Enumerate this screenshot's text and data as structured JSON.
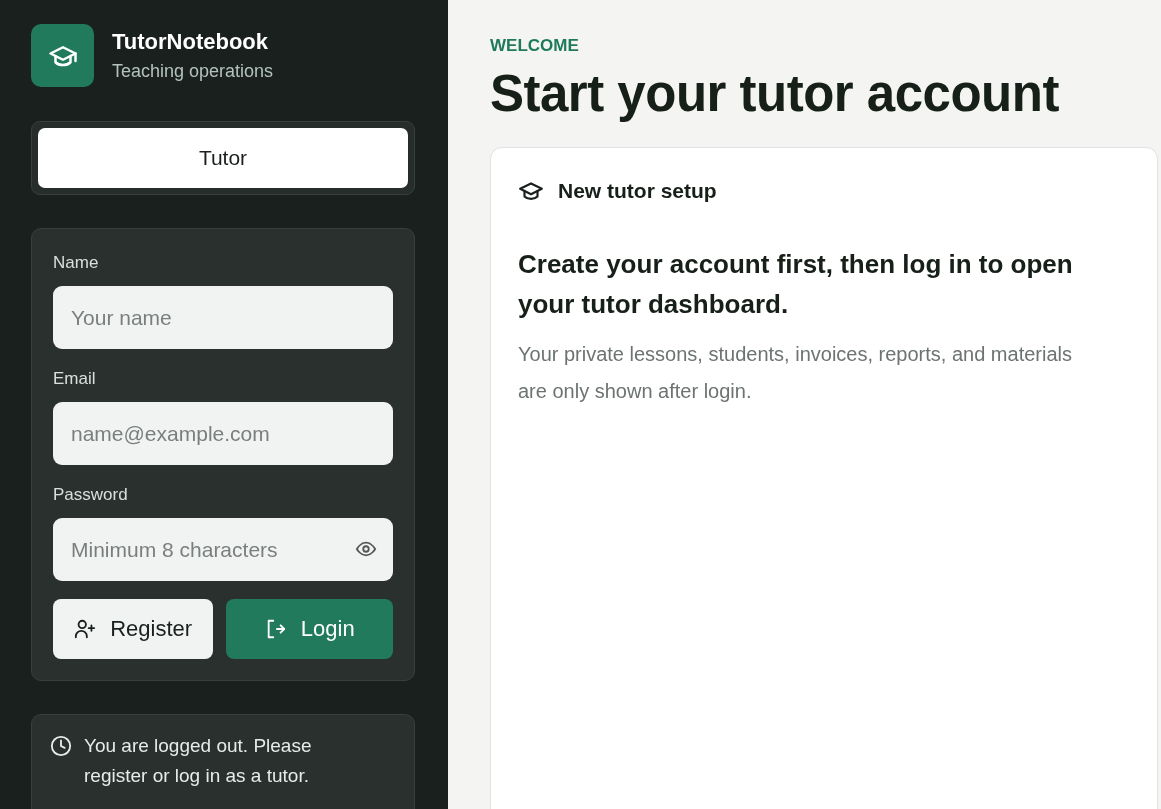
{
  "brand": {
    "name": "TutorNotebook",
    "tagline": "Teaching operations"
  },
  "roles": [
    {
      "label": "Tutor",
      "selected": true
    }
  ],
  "form": {
    "fields": [
      {
        "label": "Name",
        "placeholder": "Your name",
        "kind": "text"
      },
      {
        "label": "Email",
        "placeholder": "name@example.com",
        "kind": "text"
      },
      {
        "label": "Password",
        "placeholder": "Minimum 8 characters",
        "kind": "password"
      }
    ],
    "buttons": [
      {
        "label": "Register",
        "kind": "secondary"
      },
      {
        "label": "Login",
        "kind": "primary"
      }
    ]
  },
  "notice": "You are logged out. Please register or log in as a tutor.",
  "main": {
    "eyebrow": "WELCOME",
    "title": "Start your tutor account",
    "card": {
      "title": "New tutor setup",
      "heading": "Create your account first, then log in to open your tutor dashboard.",
      "body": "Your private lessons, students, invoices, reports, and materials are only shown after login."
    }
  }
}
